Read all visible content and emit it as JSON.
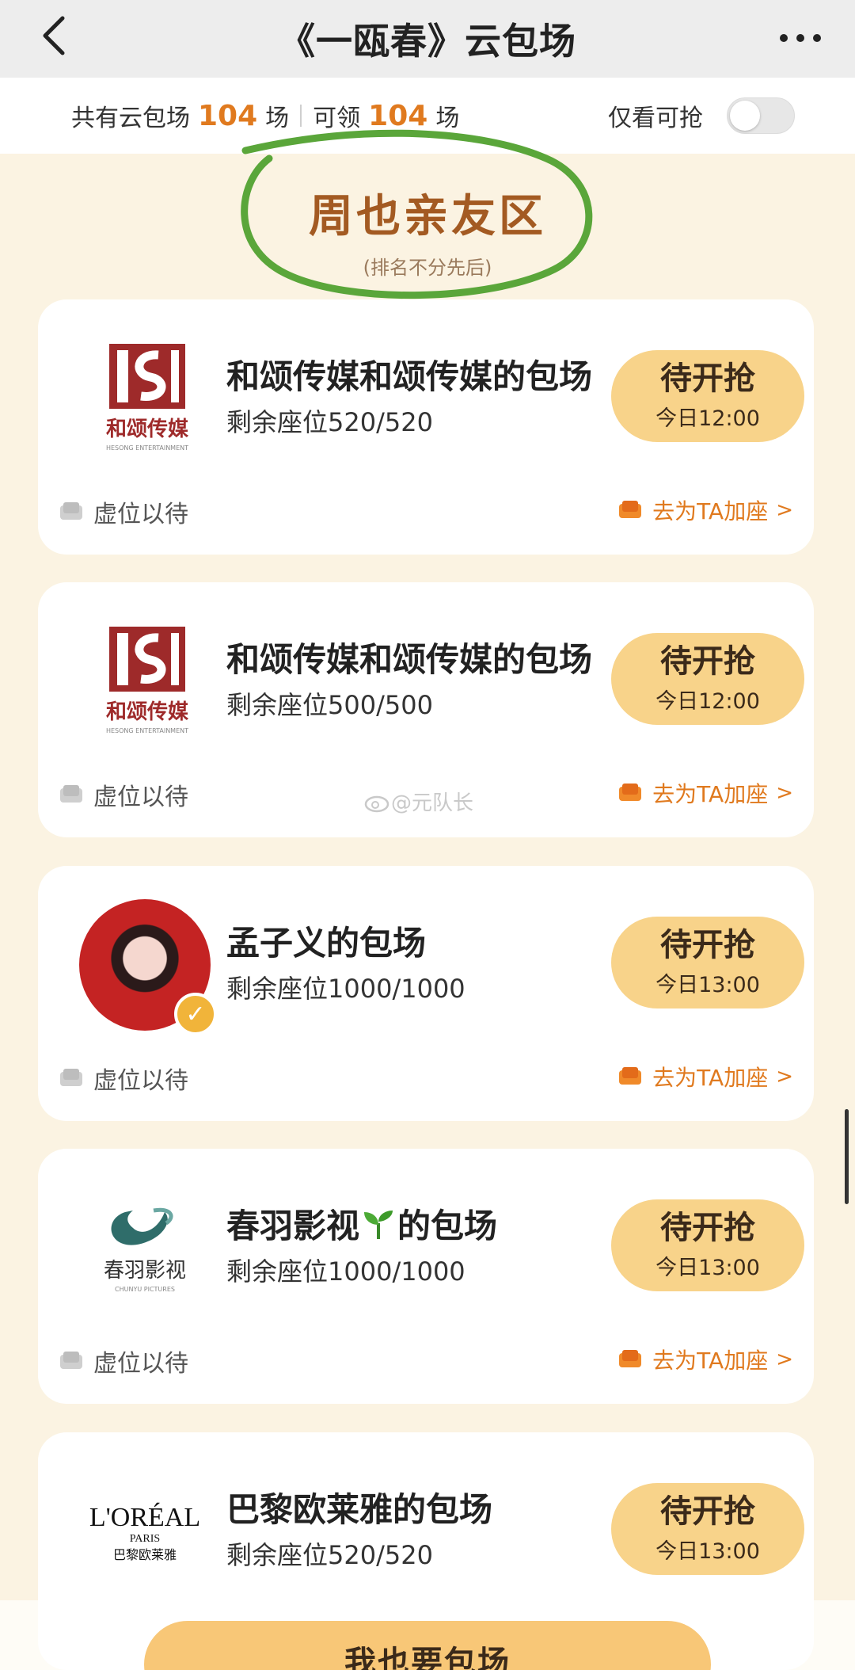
{
  "navbar": {
    "title": "《一瓯春》云包场"
  },
  "summary": {
    "total_prefix": "共有云包场",
    "total_count": "104",
    "total_suffix": "场",
    "claim_prefix": "可领",
    "claim_count": "104",
    "claim_suffix": "场",
    "toggle_label": "仅看可抢"
  },
  "section": {
    "title": "周也亲友区",
    "subtitle": "(排名不分先后)"
  },
  "cards": [
    {
      "title": "和颂传媒和颂传媒的包场",
      "seats": "剩余座位520/520",
      "button_label": "待开抢",
      "button_time": "今日12:00",
      "left_action": "虚位以待",
      "right_action": "去为TA加座",
      "logo": "hesong-logo"
    },
    {
      "title": "和颂传媒和颂传媒的包场",
      "seats": "剩余座位500/500",
      "button_label": "待开抢",
      "button_time": "今日12:00",
      "left_action": "虚位以待",
      "right_action": "去为TA加座",
      "logo": "hesong-logo"
    },
    {
      "title": "孟子义的包场",
      "seats": "剩余座位1000/1000",
      "button_label": "待开抢",
      "button_time": "今日13:00",
      "left_action": "虚位以待",
      "right_action": "去为TA加座",
      "logo": "avatar"
    },
    {
      "title": "春羽影视",
      "title_suffix": "的包场",
      "seats": "剩余座位1000/1000",
      "button_label": "待开抢",
      "button_time": "今日13:00",
      "left_action": "虚位以待",
      "right_action": "去为TA加座",
      "logo": "chunyu-logo"
    },
    {
      "title": "巴黎欧莱雅的包场",
      "seats": "剩余座位520/520",
      "button_label": "待开抢",
      "button_time": "今日13:00",
      "logo": "loreal-logo"
    }
  ],
  "logos": {
    "hesong_text": "和颂传媒",
    "hesong_sub": "HESONG ENTERTAINMENT",
    "chunyu_text": "春羽影视",
    "chunyu_sub": "CHUNYU PICTURES",
    "loreal_brand": "L'ORÉAL",
    "loreal_city": "PARIS",
    "loreal_cn": "巴黎欧莱雅"
  },
  "watermark": "@元队长",
  "cta": {
    "label": "我也要包场"
  },
  "colors": {
    "accent": "#e07a1f",
    "button_bg": "#f8d38a",
    "section_title": "#a35a22",
    "page_bg": "#fbf3e2",
    "circle_mark": "#5aa63a"
  }
}
